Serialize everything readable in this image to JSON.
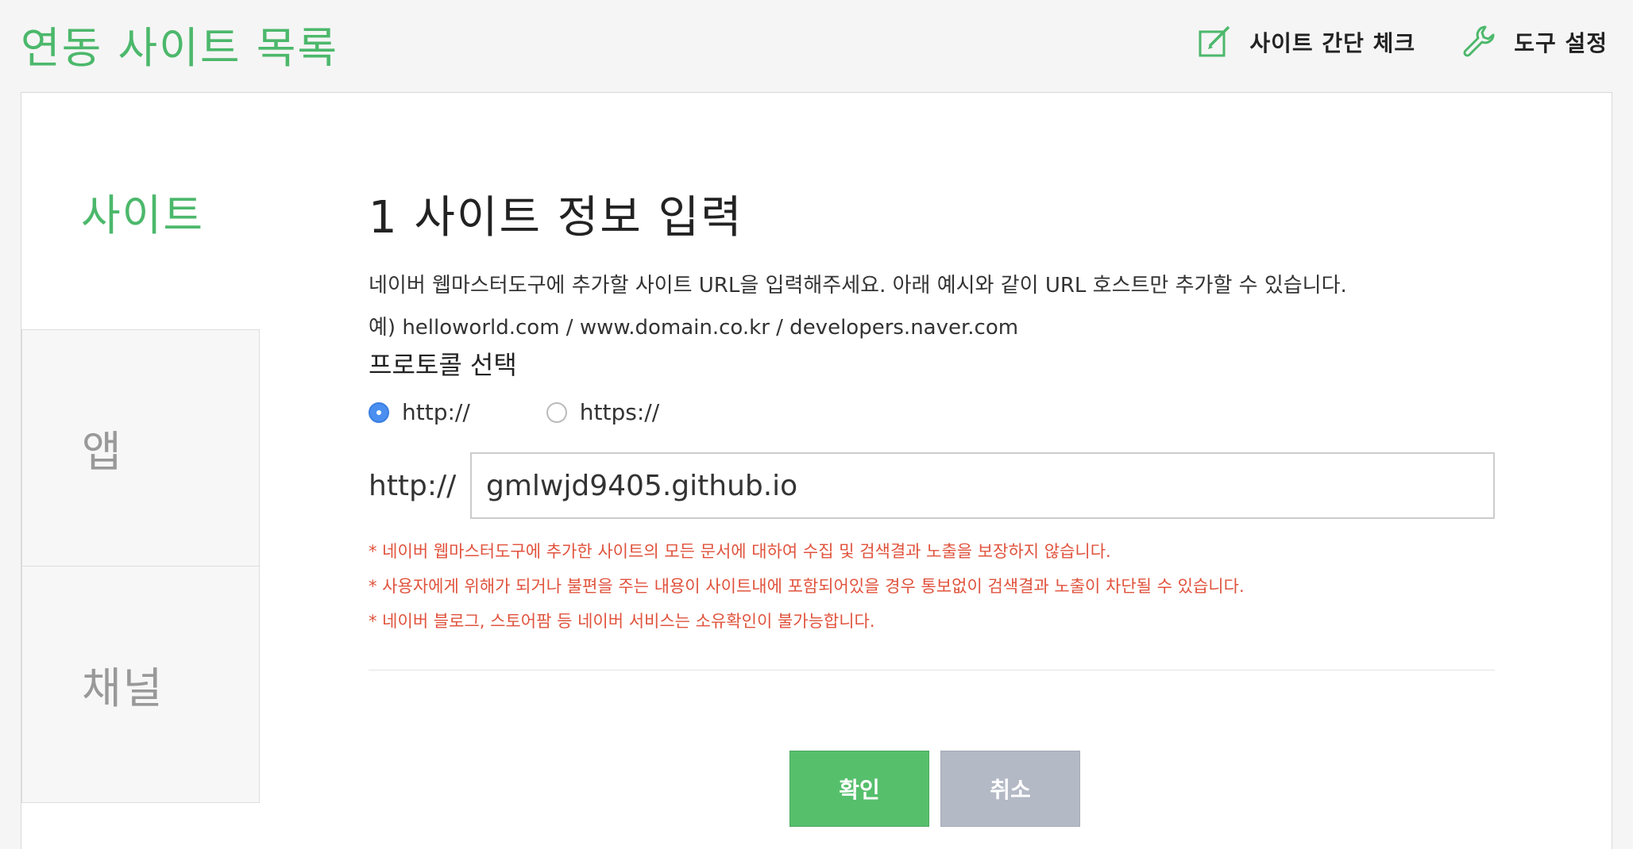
{
  "header": {
    "title": "연동 사이트 목록",
    "actions": [
      {
        "label": "사이트 간단 체크",
        "icon": "edit-check-icon"
      },
      {
        "label": "도구 설정",
        "icon": "wrench-icon"
      }
    ]
  },
  "colors": {
    "accent": "#4cb86b",
    "warning": "#e0533d",
    "radio_checked": "#4a8ff0",
    "cancel": "#b3b9c5"
  },
  "sidebar": {
    "tabs": [
      {
        "label": "사이트",
        "active": true
      },
      {
        "label": "앱",
        "active": false
      },
      {
        "label": "채널",
        "active": false
      }
    ]
  },
  "form": {
    "step_title": "1 사이트 정보 입력",
    "description": "네이버 웹마스터도구에 추가할 사이트 URL을 입력해주세요. 아래 예시와 같이 URL 호스트만 추가할 수 있습니다.",
    "example": "예) helloworld.com / www.domain.co.kr / developers.naver.com",
    "protocol_label": "프로토콜 선택",
    "protocol_options": [
      {
        "label": "http://",
        "checked": true
      },
      {
        "label": "https://",
        "checked": false
      }
    ],
    "url_prefix": "http://",
    "url_value": "gmlwjd9405.github.io",
    "warnings": [
      "* 네이버 웹마스터도구에 추가한 사이트의 모든 문서에 대하여 수집 및 검색결과 노출을 보장하지 않습니다.",
      "* 사용자에게 위해가 되거나 불편을 주는 내용이 사이트내에 포함되어있을 경우 통보없이 검색결과 노출이 차단될 수 있습니다.",
      "* 네이버 블로그, 스토어팜 등 네이버 서비스는 소유확인이 불가능합니다."
    ],
    "confirm_label": "확인",
    "cancel_label": "취소"
  }
}
